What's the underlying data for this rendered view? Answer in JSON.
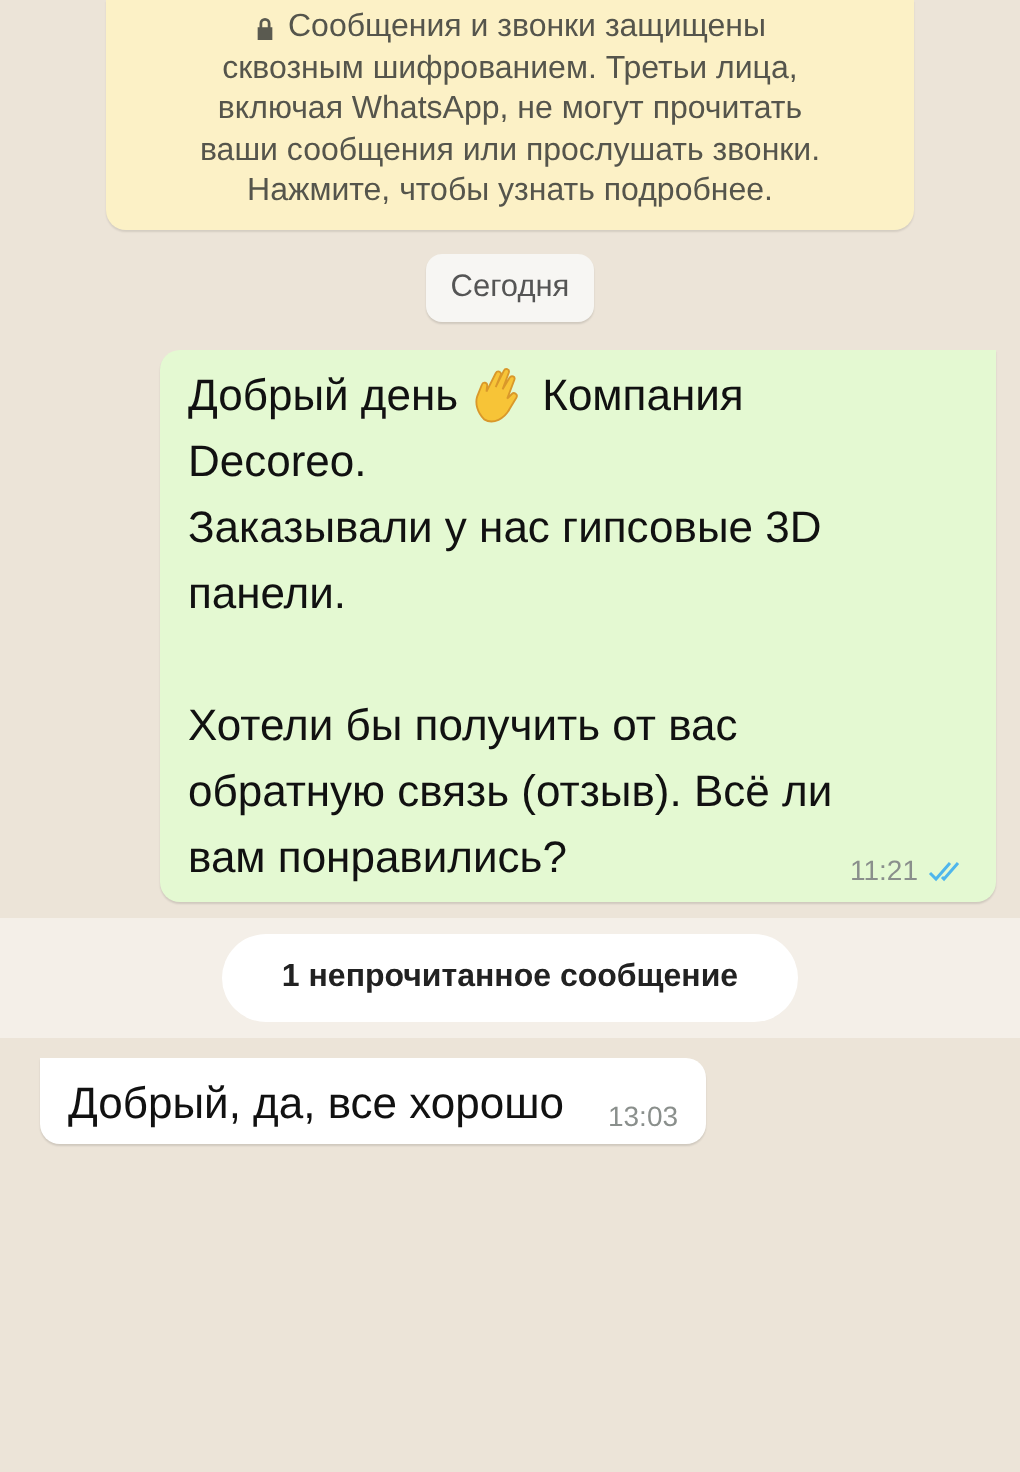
{
  "encryption_notice": {
    "lines": [
      "Сообщения и звонки защищены",
      "сквозным шифрованием. Третьи лица,",
      "включая WhatsApp, не могут прочитать",
      "ваши сообщения или прослушать звонки.",
      "Нажмите, чтобы узнать подробнее."
    ]
  },
  "date_chip": "Сегодня",
  "messages": [
    {
      "kind": "outgoing",
      "time": "11:21",
      "read": true,
      "paragraphs": [
        {
          "lines": [
            {
              "parts": [
                "Добрый день",
                "Компания"
              ]
            },
            {
              "parts": [
                "Decoreo."
              ]
            },
            {
              "parts": [
                "Заказывали у нас гипсовые 3D"
              ]
            },
            {
              "parts": [
                "панели."
              ]
            }
          ]
        },
        {
          "lines": [
            {
              "parts": [
                "Хотели бы получить от вас"
              ]
            },
            {
              "parts": [
                "обратную связь (отзыв). Всё ли"
              ]
            },
            {
              "parts": [
                "вам понравились?"
              ]
            }
          ]
        }
      ]
    },
    {
      "kind": "unread_banner",
      "text": "1 непрочитанное сообщение"
    },
    {
      "kind": "incoming",
      "time": "13:03",
      "paragraphs": [
        {
          "lines": [
            {
              "parts": [
                "Добрый, да, все хорошо"
              ]
            }
          ]
        }
      ]
    }
  ]
}
